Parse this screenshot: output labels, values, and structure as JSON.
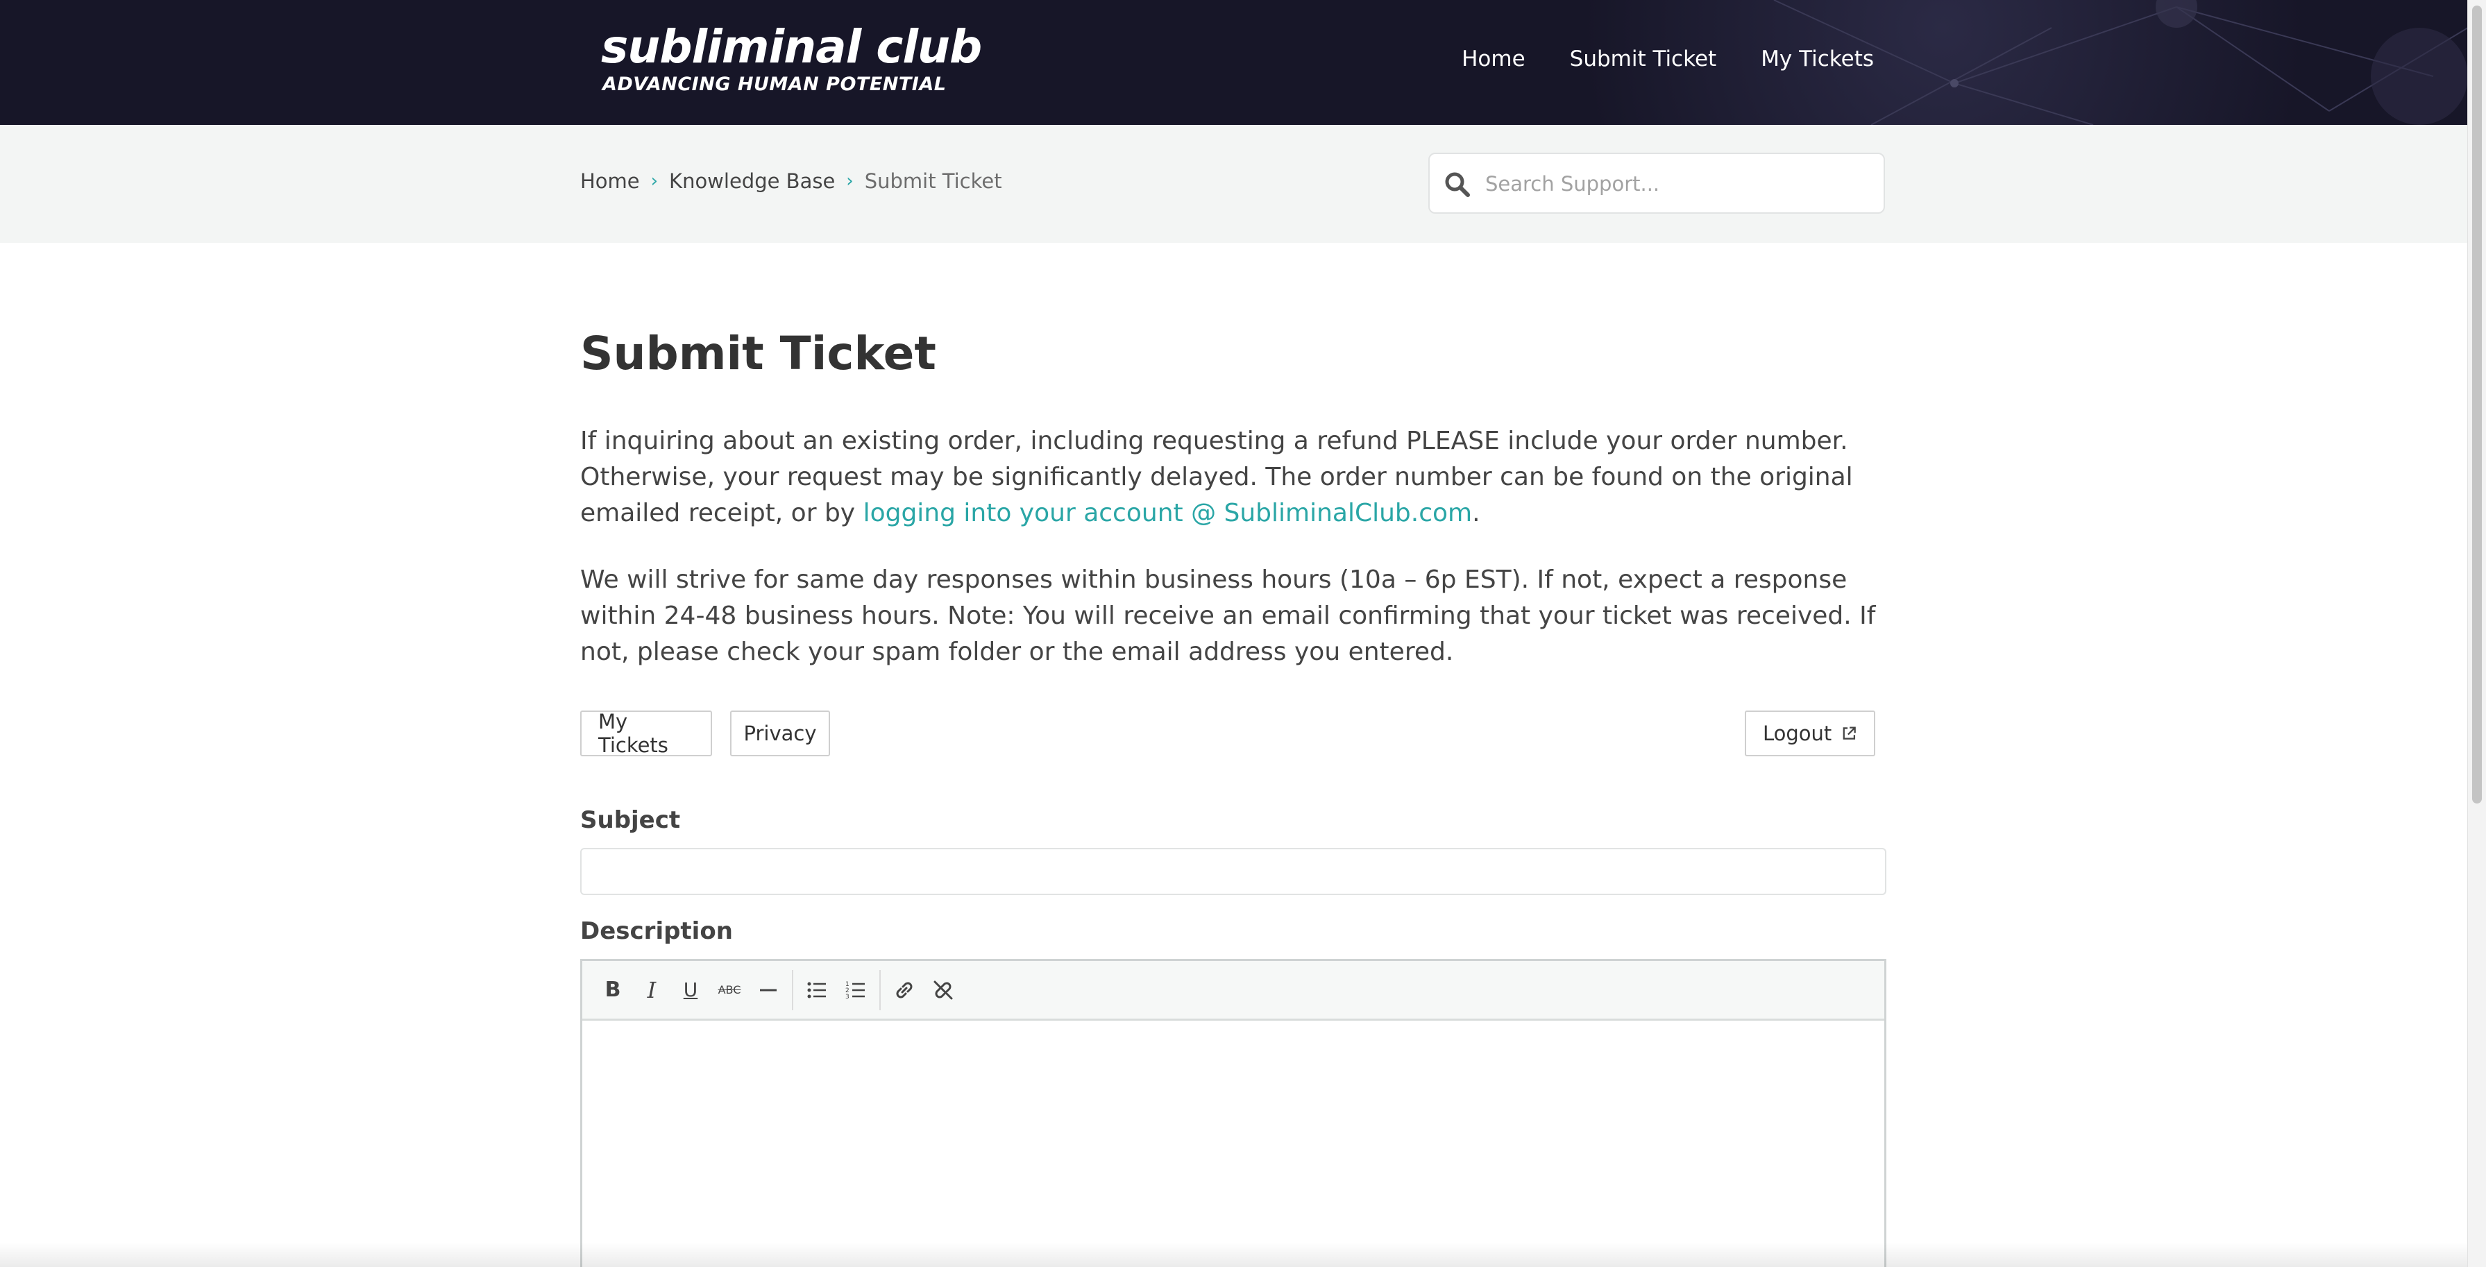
{
  "header": {
    "logo_main": "subliminal club",
    "logo_sub": "ADVANCING HUMAN POTENTIAL",
    "nav": [
      {
        "label": "Home"
      },
      {
        "label": "Submit Ticket"
      },
      {
        "label": "My Tickets"
      }
    ]
  },
  "breadcrumb": {
    "items": [
      "Home",
      "Knowledge Base",
      "Submit Ticket"
    ]
  },
  "search": {
    "placeholder": "Search Support..."
  },
  "main": {
    "title": "Submit Ticket",
    "para1_text": "If inquiring about an existing order, including requesting a refund PLEASE include your order number. Otherwise, your request may be significantly delayed. The order number can be found on the original emailed receipt, or by ",
    "para1_link": "logging into your account @ SubliminalClub.com",
    "para1_end": ".",
    "para2": "We will strive for same day responses within business hours (10a – 6p EST). If not, expect a response within 24-48 business hours. Note: You will receive an email confirming that your ticket was received. If not, please check your spam folder or the email address you entered.",
    "buttons": {
      "my_tickets": "My Tickets",
      "privacy": "Privacy",
      "logout": "Logout"
    },
    "subject_label": "Subject",
    "subject_value": "",
    "description_label": "Description"
  },
  "colors": {
    "header_bg": "#171628",
    "accent": "#2aa6a6",
    "subbar_bg": "#f3f5f4"
  },
  "icons": {
    "search": "search-icon",
    "external_link": "external-link-icon",
    "toolbar": [
      "bold-icon",
      "italic-icon",
      "underline-icon",
      "strikethrough-icon",
      "horizontal-rule-icon",
      "bullet-list-icon",
      "numbered-list-icon",
      "link-icon",
      "unlink-icon"
    ]
  }
}
